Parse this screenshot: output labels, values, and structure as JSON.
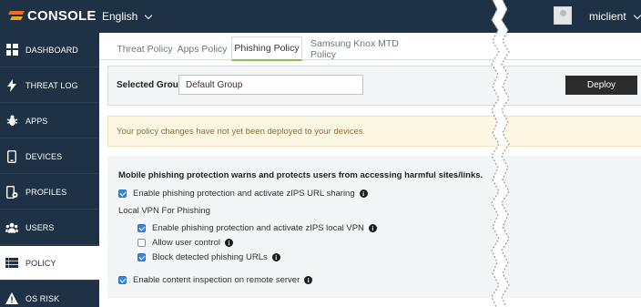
{
  "header": {
    "logo_text": "CONSOLE",
    "language": "English",
    "username": "miclient"
  },
  "sidebar": {
    "items": [
      {
        "label": "DASHBOARD",
        "icon": "dashboard-icon",
        "active": false
      },
      {
        "label": "THREAT LOG",
        "icon": "lightning-icon",
        "active": false
      },
      {
        "label": "APPS",
        "icon": "bug-icon",
        "active": false
      },
      {
        "label": "DEVICES",
        "icon": "phone-icon",
        "active": false
      },
      {
        "label": "PROFILES",
        "icon": "profile-gear-icon",
        "active": false
      },
      {
        "label": "USERS",
        "icon": "users-icon",
        "active": false
      },
      {
        "label": "POLICY",
        "icon": "list-icon",
        "active": true
      },
      {
        "label": "OS RISK",
        "icon": "warning-icon",
        "active": false
      }
    ]
  },
  "tabs": [
    {
      "label": "Threat Policy",
      "active": false
    },
    {
      "label": "Apps Policy",
      "active": false
    },
    {
      "label": "Phishing Policy",
      "active": true
    },
    {
      "label": "Samsung Knox MTD Policy",
      "active": false
    }
  ],
  "group": {
    "label": "Selected Group",
    "value": "Default Group",
    "deploy_label": "Deploy"
  },
  "alert": {
    "text": "Your policy changes have not yet been deployed to your devices"
  },
  "settings": {
    "heading": "Mobile phishing protection warns and protects users from accessing harmful sites/links.",
    "url_sharing": {
      "label": "Enable phishing protection and activate zIPS URL sharing",
      "checked": true
    },
    "local_vpn_label": "Local VPN For Phishing",
    "local_vpn": {
      "label": "Enable phishing protection and activate zIPS local VPN",
      "checked": true
    },
    "user_control": {
      "label": "Allow user control",
      "checked": false
    },
    "block_urls": {
      "label": "Block detected phishing URLs",
      "checked": true
    },
    "content_inspection": {
      "label": "Enable content inspection on remote server",
      "checked": true
    }
  },
  "colors": {
    "sidebar_bg": "#1f3144",
    "active_tab_underline": "#8bc34a",
    "checkbox_blue": "#3b86d8",
    "alert_bg": "#fcf8e3",
    "alert_text": "#8a6d3b"
  }
}
